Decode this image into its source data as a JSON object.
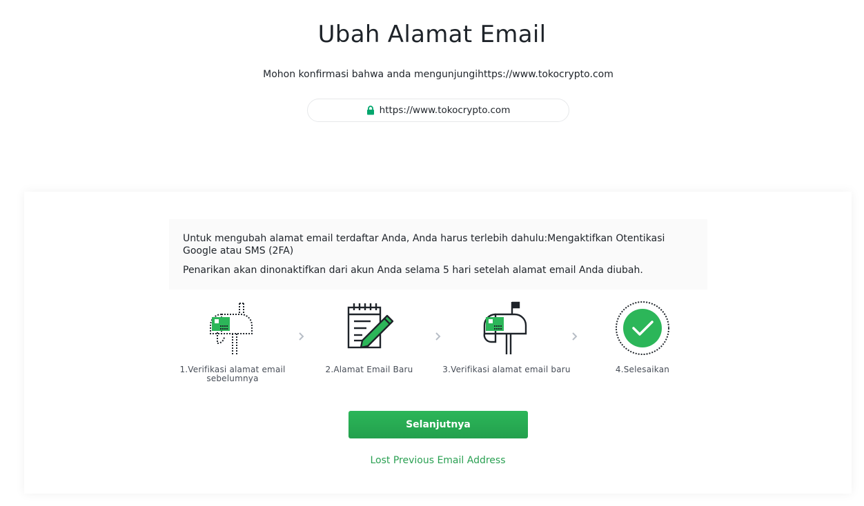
{
  "header": {
    "title": "Ubah Alamat Email",
    "confirm_text": "Mohon konfirmasi bahwa anda mengunjungihttps://www.tokocrypto.com",
    "url": "https://www.tokocrypto.com",
    "lock_icon": "lock-icon"
  },
  "notice": {
    "line1": "Untuk mengubah alamat email terdaftar Anda, Anda harus terlebih dahulu:Mengaktifkan Otentikasi Google atau SMS (2FA)",
    "line2": "Penarikan akan dinonaktifkan dari akun Anda selama 5 hari setelah alamat email Anda diubah."
  },
  "steps": [
    {
      "label": "1.Verifikasi alamat email sebelumnya",
      "icon": "mailbox-dotted-icon"
    },
    {
      "label": "2.Alamat Email Baru",
      "icon": "notepad-pencil-icon"
    },
    {
      "label": "3.Verifikasi alamat email baru",
      "icon": "mailbox-icon"
    },
    {
      "label": "4.Selesaikan",
      "icon": "check-circle-icon"
    }
  ],
  "actions": {
    "next_label": "Selanjutnya",
    "lost_link": "Lost Previous Email Address"
  },
  "colors": {
    "accent": "#2cb659",
    "link": "#2aa052",
    "lock": "#03a66d",
    "text": "#1e2329"
  }
}
